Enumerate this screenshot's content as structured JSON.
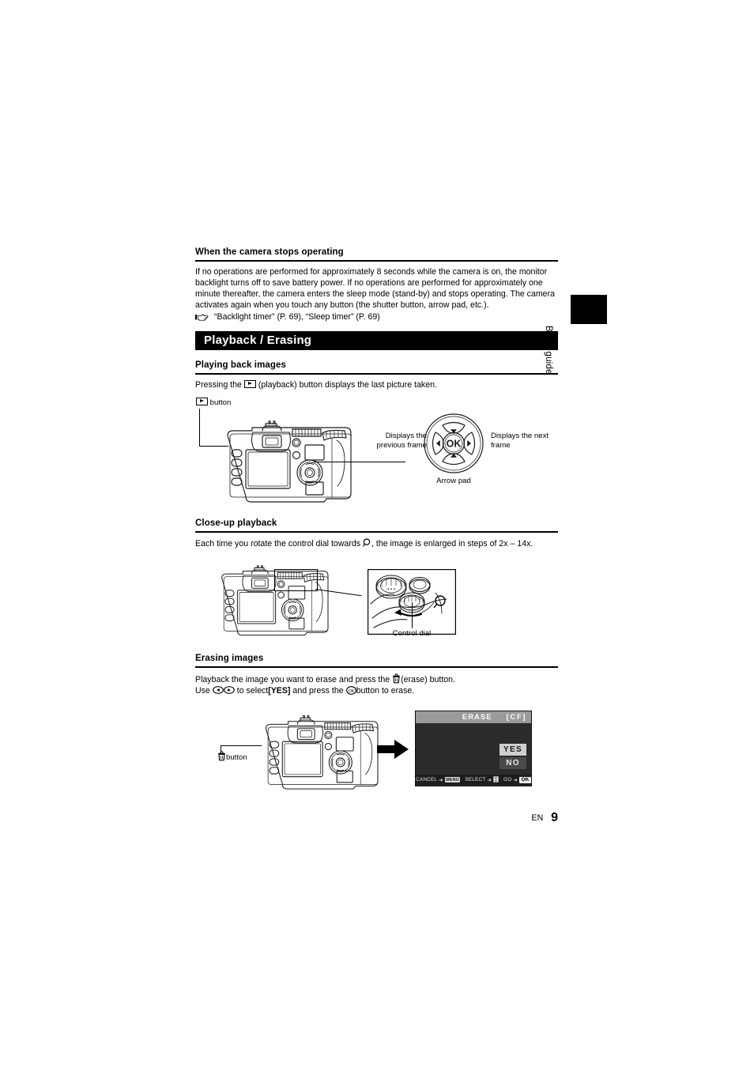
{
  "page": {
    "footer_lang": "EN",
    "footer_page": "9",
    "side_tab_label": "Basic guide"
  },
  "section_stop": {
    "heading": "When the camera stops operating",
    "paragraph": "If no operations are performed for approximately 8 seconds while the camera is on, the monitor backlight turns off to save battery power. If no operations are performed for approximately one minute thereafter, the camera enters the sleep mode (stand-by) and stops operating. The camera activates again when you touch any button (the shutter button, arrow pad, etc.).",
    "reference": "“Backlight timer” (P. 69), “Sleep timer” (P. 69)"
  },
  "section_bar": {
    "title": "Playback / Erasing"
  },
  "playing_back": {
    "heading": "Playing back images",
    "text_before_icon": "Pressing the",
    "text_after_icon": "(playback) button displays the last picture taken.",
    "button_label": "button",
    "caption_prev": "Displays the previous frame",
    "caption_prev_line1": "Displays the",
    "caption_prev_line2": "previous frame",
    "caption_next_line1": "Displays the next",
    "caption_next_line2": "frame",
    "arrow_pad_label": "Arrow pad",
    "ok_label": "OK"
  },
  "close_up": {
    "heading": "Close-up playback",
    "text_before_icon": "Each time you rotate the control dial towards",
    "text_after_icon": ", the image is enlarged in steps of 2x – 14x.",
    "control_dial_label": "Control dial"
  },
  "erasing": {
    "heading": "Erasing images",
    "line1_before_icon": "Playback the image you want to erase and press the",
    "line1_after_icon": "(erase) button.",
    "line2_part1": "Use",
    "line2_part2": "to select",
    "line2_bracket": "[YES]",
    "line2_part3": "and press the",
    "line2_part4": "button to erase.",
    "button_label": "button"
  },
  "lcd": {
    "title": "ERASE",
    "card": "[CF]",
    "yes": "YES",
    "no": "NO",
    "bar_cancel": "CANCEL",
    "bar_cancel_chip": "MENU",
    "bar_select": "SELECT",
    "bar_go": "GO",
    "bar_go_chip": "OK",
    "arrow": "➔"
  },
  "colors": {
    "ink": "#000000",
    "paper": "#ffffff",
    "bar_bg": "#000000",
    "bar_text": "#ffffff",
    "lcd_bg": "#2b2b2b",
    "lcd_title_bg": "#9a9a9a",
    "lcd_yes_bg": "#cfcfcf",
    "lcd_no_bg": "#4a4a4a"
  }
}
